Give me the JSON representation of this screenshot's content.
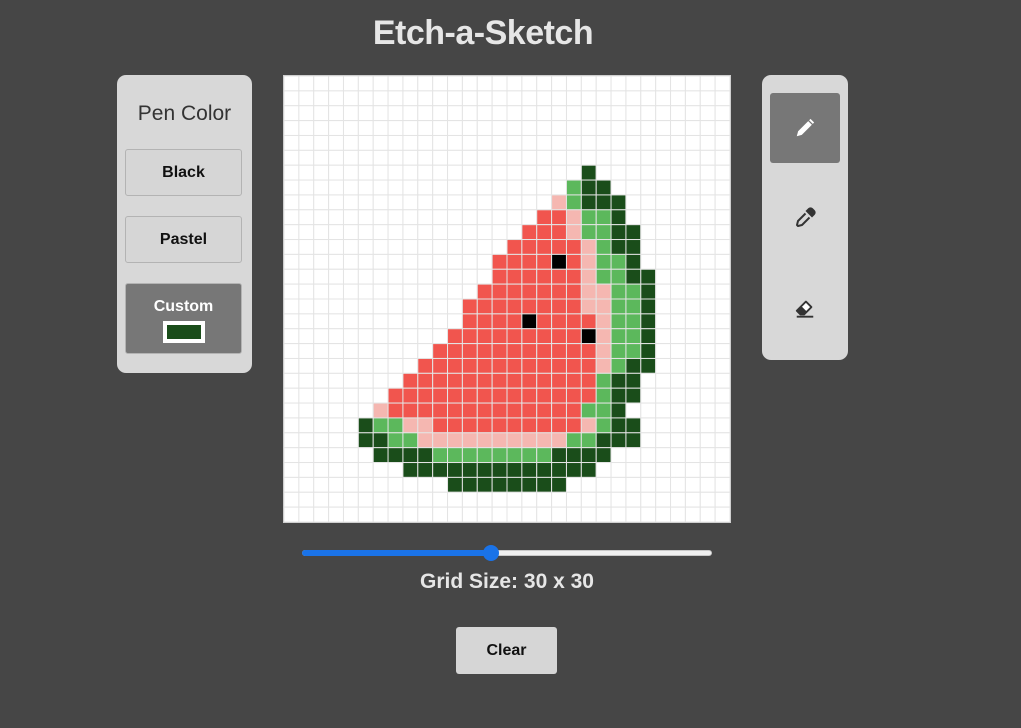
{
  "title": "Etch-a-Sketch",
  "pen_color_panel": {
    "heading": "Pen Color",
    "buttons": [
      {
        "label": "Black",
        "selected": false
      },
      {
        "label": "Pastel",
        "selected": false
      },
      {
        "label": "Custom",
        "selected": true
      }
    ],
    "custom_color": "#1a4d1a"
  },
  "tools": [
    {
      "name": "pencil-icon",
      "selected": true
    },
    {
      "name": "eyedropper-icon",
      "selected": false
    },
    {
      "name": "eraser-icon",
      "selected": false
    }
  ],
  "grid": {
    "size": 30,
    "colors": {
      "D": "#1a4d1a",
      "G": "#5cb85c",
      "P": "#f5b7b1",
      "R": "#f1554e",
      "K": "#000000",
      "empty": "#ffffff",
      "line": "#e4e4e4"
    },
    "rows": [
      "..............................",
      "..............................",
      "..............................",
      "..............................",
      "..............................",
      "..............................",
      "....................D.........",
      "...................GDD........",
      "..................PGDDD.......",
      ".................RRPGGD.......",
      "................RRRPGGDD......",
      "...............RRRRRPGDD......",
      "..............RRRRKRPGGD......",
      "..............RRRRRRPGGDD.....",
      ".............RRRRRRRPPGGD.....",
      "............RRRRRRRRPPGGD.....",
      "............RRRRKRRRRPGGD.....",
      "...........RRRRRRRRRKPGGD.....",
      "..........RRRRRRRRRRRPGGD.....",
      ".........RRRRRRRRRRRRPGDD.....",
      "........RRRRRRRRRRRRRGDD......",
      ".......RRRRRRRRRRRRRRGDD.......",
      "......PRRRRRRRRRRRRRGGD........",
      ".....DGGPPRRRRRRRRRRPGDD.......",
      ".....DDGGPPPPPPPPPPGGDDD.......",
      "......DDDDGGGGGGGGDDDD........",
      "........DDDDDDDDDDDDD.........",
      "...........DDDDDDDD...........",
      "..............................",
      ".............................."
    ]
  },
  "slider": {
    "min": 1,
    "max": 64,
    "value": 30
  },
  "grid_size_label": {
    "prefix": "Grid Size:",
    "value": "30 x 30"
  },
  "clear_label": "Clear"
}
